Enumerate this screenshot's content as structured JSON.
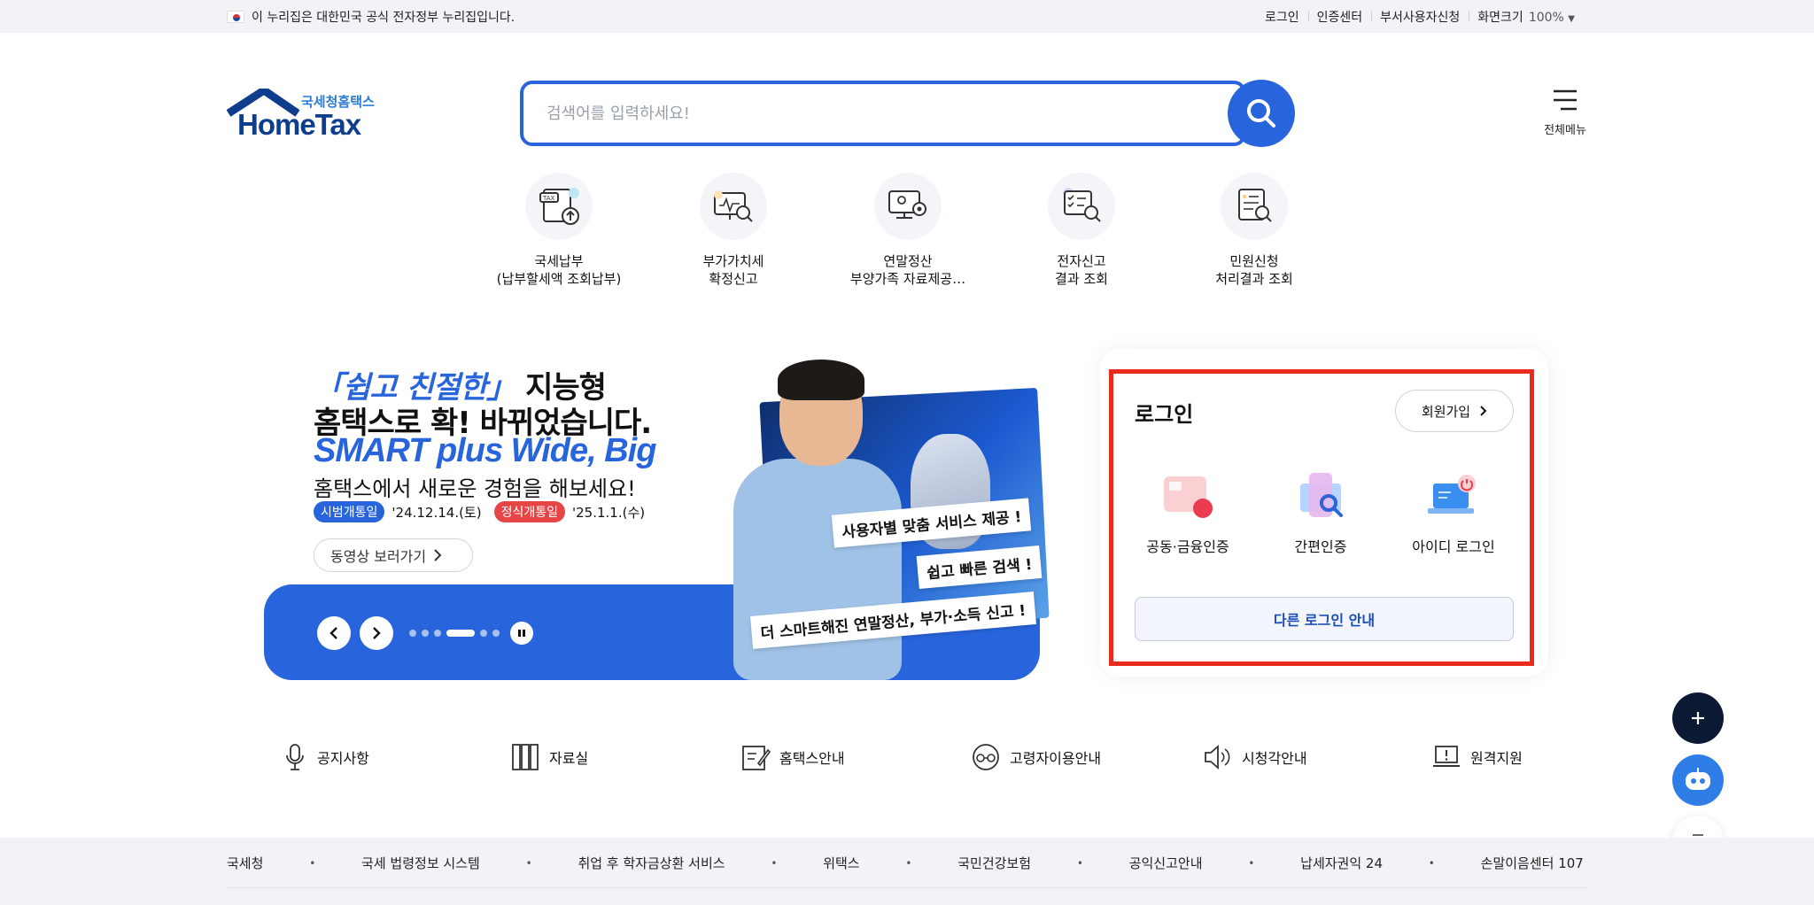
{
  "gov_bar": {
    "notice": "이 누리집은 대한민국 공식 전자정부 누리집입니다.",
    "links": [
      "로그인",
      "인증센터",
      "부서사용자신청",
      "화면크기"
    ],
    "zoom": "100%"
  },
  "header": {
    "logo_sub": "국세청홈택스",
    "logo_main": "HomeTax",
    "search_placeholder": "검색어를 입력하세요!",
    "all_menu_label": "전체메뉴"
  },
  "quick_menu": [
    {
      "label": "국세납부\n(납부할세액 조회납부)",
      "icon": "tax-document-upload-icon"
    },
    {
      "label": "부가가치세\n확정신고",
      "icon": "monitor-search-icon"
    },
    {
      "label": "연말정산\n부양가족 자료제공…",
      "icon": "monitor-settings-icon"
    },
    {
      "label": "전자신고\n결과 조회",
      "icon": "checklist-search-icon"
    },
    {
      "label": "민원신청\n처리결과 조회",
      "icon": "document-search-icon"
    }
  ],
  "banner": {
    "title_highlight": "「쉽고 친절한」",
    "title_rest": " 지능형",
    "title_line2": "홈택스로 확! 바뀌었습니다.",
    "title_line3": "SMART plus Wide, Big",
    "subtitle": "홈택스에서 새로운 경험을 해보세요!",
    "pill1": "시범개통일",
    "date1": "'24.12.14.(토)",
    "pill2": "정식개통일",
    "date2": "'25.1.1.(수)",
    "video_label": "동영상 보러가기",
    "tag1": "사용자별 맞춤 서비스 제공 !",
    "tag2": "쉽고 빠른 검색 !",
    "tag3": "더 스마트해진 연말정산, 부가·소득 신고 !",
    "slide_count": 6,
    "active_slide": 4
  },
  "login": {
    "title": "로그인",
    "join_label": "회원가입",
    "methods": [
      {
        "label": "공동·금융인증",
        "icon": "certificate-icon"
      },
      {
        "label": "간편인증",
        "icon": "phone-search-icon"
      },
      {
        "label": "아이디 로그인",
        "icon": "laptop-power-icon"
      }
    ],
    "other_label": "다른 로그인 안내",
    "highlight_color": "#ea2a1c"
  },
  "link_row": [
    {
      "label": "공지사항",
      "icon": "microphone-icon"
    },
    {
      "label": "자료실",
      "icon": "bookshelf-icon"
    },
    {
      "label": "홈택스안내",
      "icon": "pencil-note-icon"
    },
    {
      "label": "고령자이용안내",
      "icon": "glasses-icon"
    },
    {
      "label": "시청각안내",
      "icon": "speaker-icon"
    },
    {
      "label": "원격지원",
      "icon": "laptop-alert-icon"
    }
  ],
  "footer_links": [
    "국세청",
    "국세 법령정보 시스템",
    "취업 후 학자금상환 서비스",
    "위택스",
    "국민건강보험",
    "공익신고안내",
    "납세자권익 24",
    "손말이음센터 107"
  ],
  "colors": {
    "brand_blue": "#2865dc",
    "navy": "#0d3d8c",
    "fab_dark": "#0b1933",
    "fab_blue": "#2f7de6"
  }
}
